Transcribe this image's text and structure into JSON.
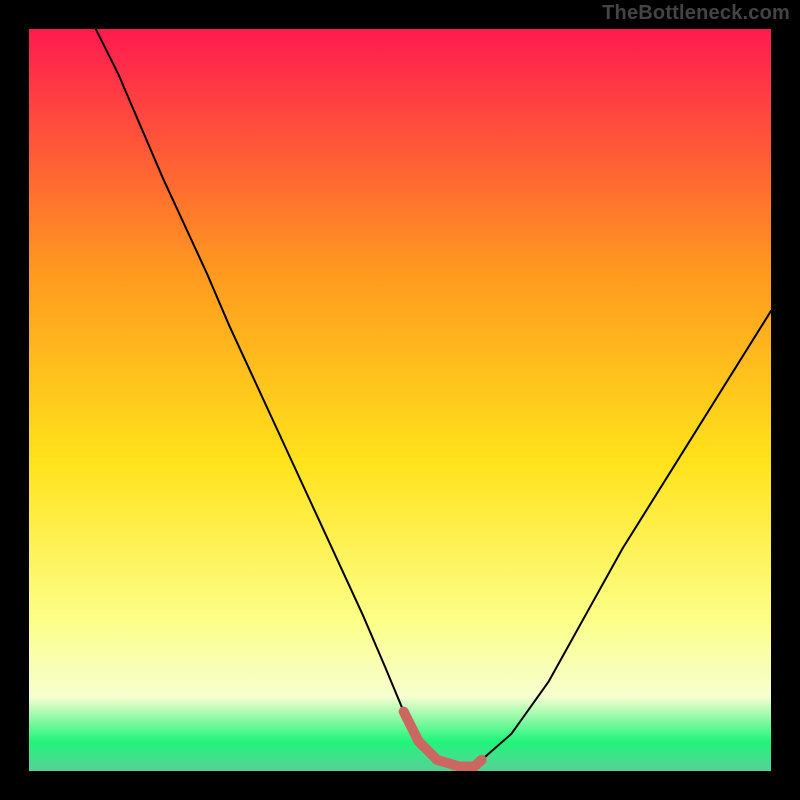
{
  "watermark": "TheBottleneck.com",
  "colors": {
    "black": "#000000",
    "curve": "#000000",
    "segment": "#cc6660",
    "grad_top": "#ff1a50",
    "grad_upper": "#ff9a1f",
    "grad_mid": "#ffe21a",
    "grad_lower": "#fcff8a",
    "grad_pale": "#f6ffd0",
    "grad_green": "#20f57a",
    "grad_green2": "#3ee38a",
    "grad_green3": "#57cf96"
  },
  "chart_data": {
    "type": "line",
    "title": "",
    "xlabel": "",
    "ylabel": "",
    "xlim": [
      0,
      100
    ],
    "ylim": [
      0,
      100
    ],
    "curve": {
      "x": [
        9,
        12,
        15,
        18,
        21,
        24,
        27,
        30,
        33,
        36,
        39,
        42,
        45,
        48,
        50.5,
        52.5,
        55,
        58,
        60,
        61,
        65,
        70,
        75,
        80,
        85,
        90,
        95,
        100
      ],
      "y": [
        100,
        94,
        87,
        80,
        73.5,
        67,
        60,
        53.5,
        47,
        40.5,
        34,
        27.5,
        21,
        14,
        8,
        4,
        1.5,
        0.6,
        0.6,
        1.5,
        5,
        12,
        21,
        30,
        38,
        46,
        54,
        62
      ]
    },
    "highlight_segment": {
      "x": [
        50.5,
        52.5,
        55,
        58,
        60,
        61
      ],
      "y": [
        8,
        4,
        1.5,
        0.6,
        0.6,
        1.5
      ]
    }
  }
}
